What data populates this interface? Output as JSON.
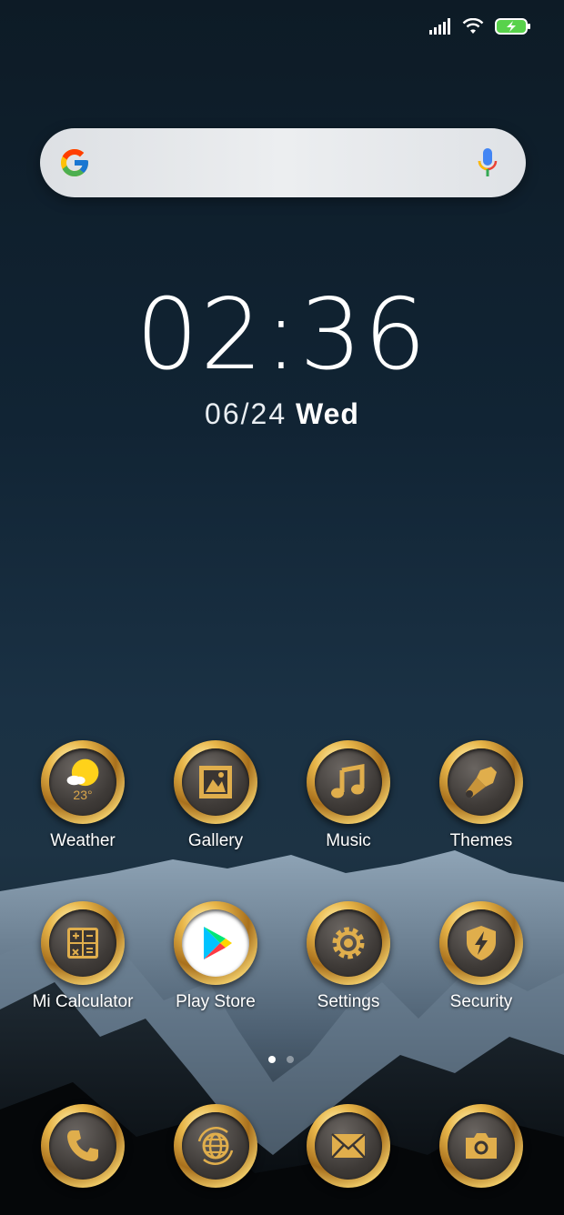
{
  "status_bar": {
    "signal_icon": "signal-bars-icon",
    "wifi_icon": "wifi-icon",
    "battery_icon": "battery-charging-icon"
  },
  "search": {
    "logo": "google-g-icon",
    "placeholder": "",
    "mic_icon": "microphone-icon"
  },
  "clock": {
    "time_h": "02",
    "time_m": "36",
    "date_md": "06/24",
    "day_of_week": "Wed"
  },
  "weather_widget": {
    "temp": "23°"
  },
  "apps_row1": [
    {
      "label": "Weather",
      "icon": "weather-sun-icon"
    },
    {
      "label": "Gallery",
      "icon": "gallery-icon"
    },
    {
      "label": "Music",
      "icon": "music-note-icon"
    },
    {
      "label": "Themes",
      "icon": "paintbrush-icon"
    }
  ],
  "apps_row2": [
    {
      "label": "Mi Calculator",
      "icon": "calculator-icon"
    },
    {
      "label": "Play Store",
      "icon": "play-store-icon"
    },
    {
      "label": "Settings",
      "icon": "gear-icon"
    },
    {
      "label": "Security",
      "icon": "shield-bolt-icon"
    }
  ],
  "dock": [
    {
      "icon": "phone-icon"
    },
    {
      "icon": "browser-globe-icon"
    },
    {
      "icon": "messages-envelope-icon"
    },
    {
      "icon": "camera-icon"
    }
  ],
  "page_indicator": {
    "pages": 2,
    "current": 1
  },
  "colors": {
    "gold": "#d6a640",
    "background": "#13263a"
  }
}
